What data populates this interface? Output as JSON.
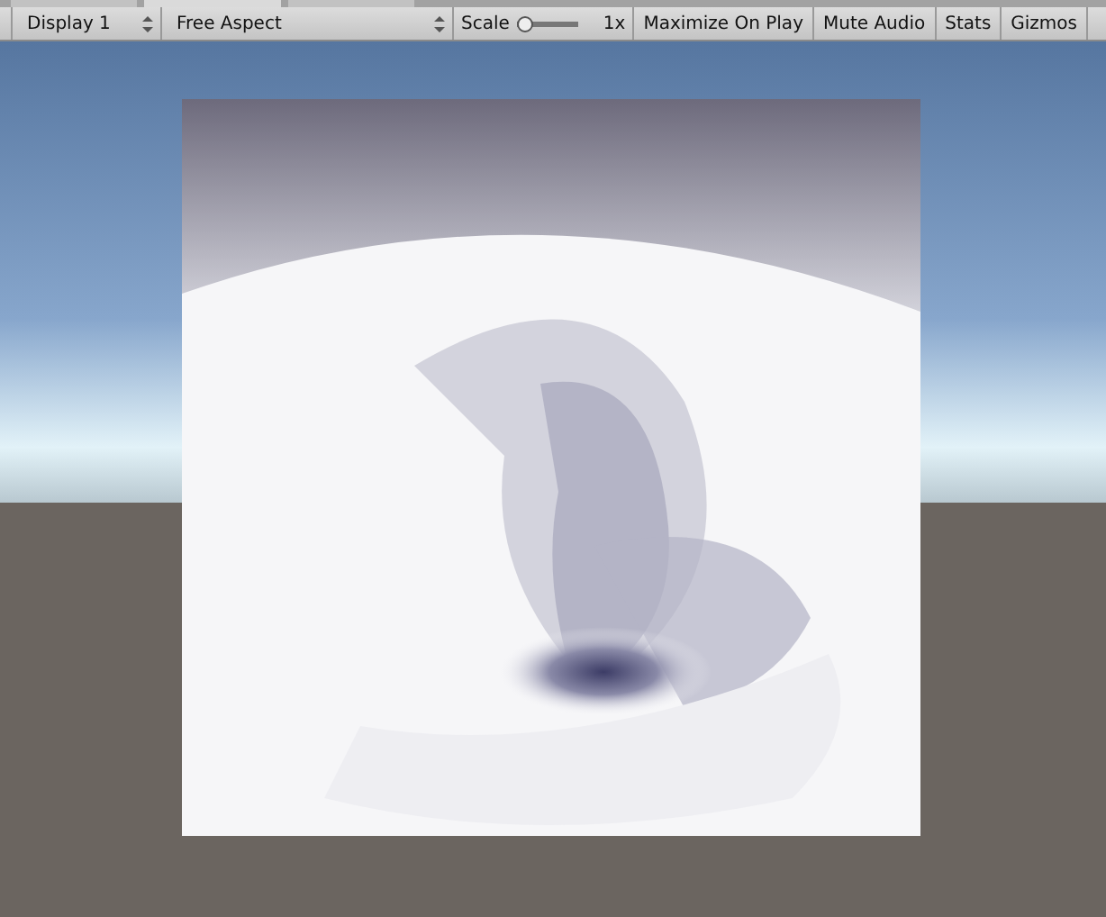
{
  "tabs": [
    {
      "selected": false
    },
    {
      "selected": true
    },
    {
      "selected": false
    }
  ],
  "toolbar": {
    "display": "Display 1",
    "aspect": "Free Aspect",
    "scale": {
      "label": "Scale",
      "level": 0,
      "reading": "1x"
    },
    "toggles": [
      {
        "label": "Maximize On Play"
      },
      {
        "label": "Mute Audio"
      },
      {
        "label": "Stats"
      },
      {
        "label": "Gizmos"
      }
    ]
  }
}
